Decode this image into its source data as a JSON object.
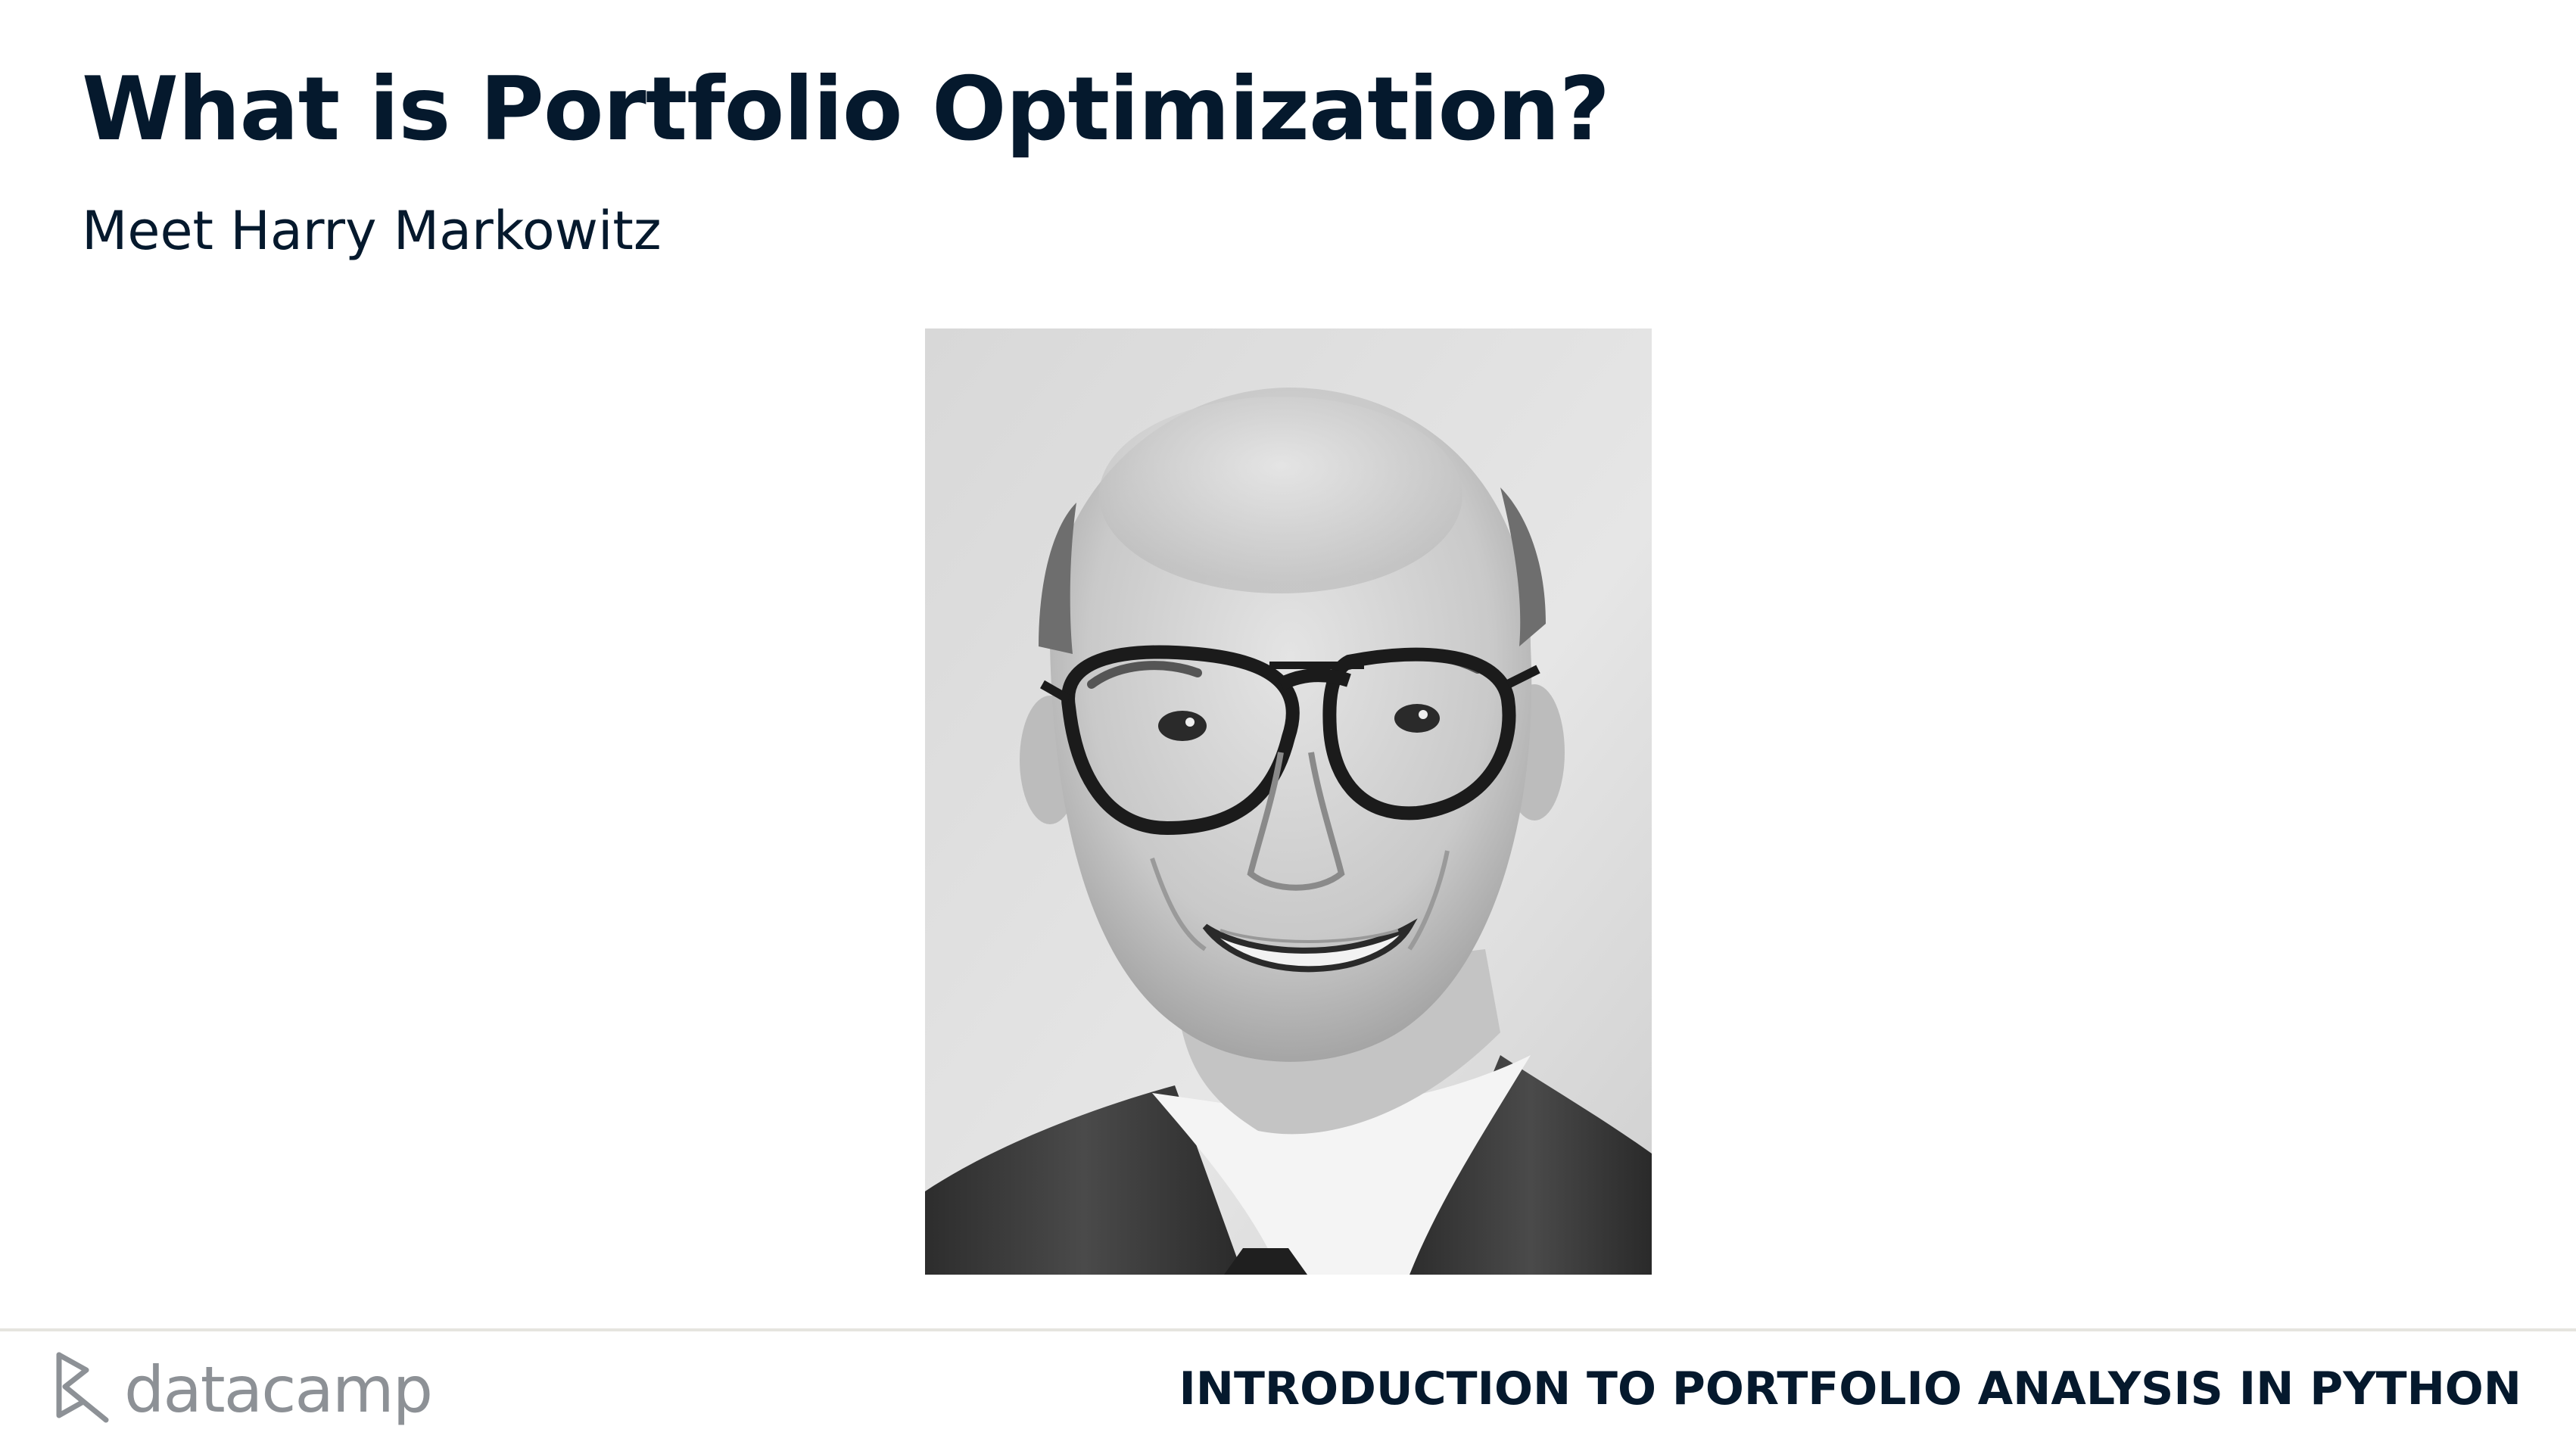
{
  "slide": {
    "title": "What is Portfolio Optimization?",
    "subtitle": "Meet Harry Markowitz"
  },
  "photo": {
    "icon": "portrait-photo-grayscale"
  },
  "footer": {
    "logo_text": "datacamp",
    "course_title": "INTRODUCTION TO PORTFOLIO ANALYSIS IN PYTHON"
  },
  "colors": {
    "title_text": "#05192d",
    "logo_gray": "#8d9196",
    "divider": "#e5e4df"
  }
}
